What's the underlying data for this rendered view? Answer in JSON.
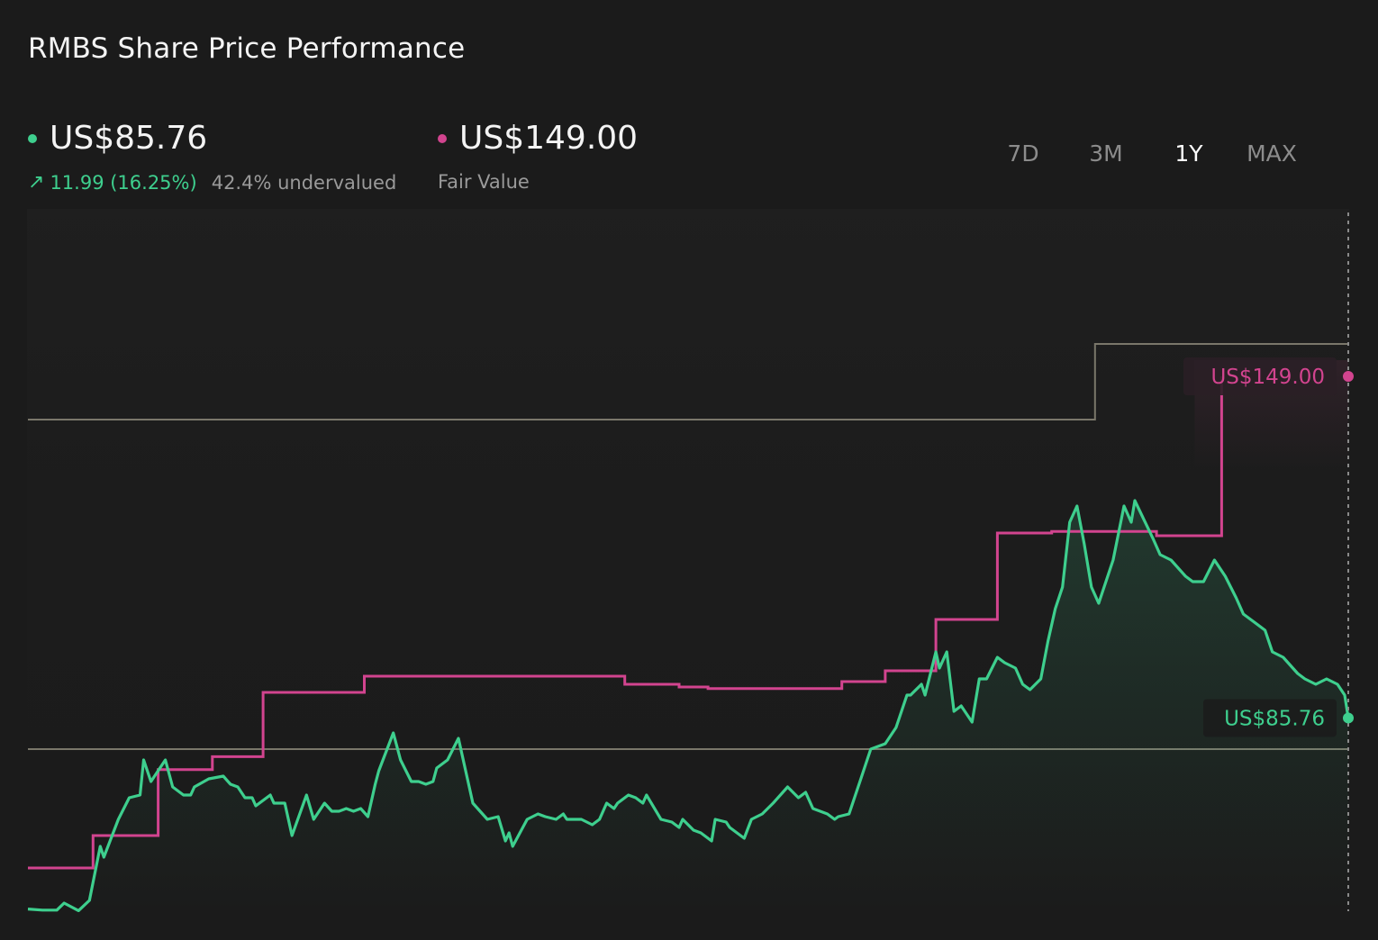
{
  "title": "RMBS Share Price Performance",
  "price": {
    "value": "US$85.76",
    "change": "11.99 (16.25%)",
    "change_arrow": "arrow-up-right-icon",
    "valuation": "42.4% undervalued",
    "color": "#3ecf8e"
  },
  "fair_value": {
    "value": "US$149.00",
    "label": "Fair Value",
    "color": "#d2448f"
  },
  "ranges": [
    {
      "label": "7D",
      "active": false
    },
    {
      "label": "3M",
      "active": false
    },
    {
      "label": "1Y",
      "active": true
    },
    {
      "label": "MAX",
      "active": false
    }
  ],
  "chart_data": {
    "type": "line",
    "x_range": [
      0,
      365
    ],
    "y_range": [
      50,
      180
    ],
    "price_label": "US$85.76",
    "fair_value_label": "US$149.00",
    "series": [
      {
        "name": "",
        "color": "#3ecf8e",
        "points": [
          [
            0,
            50.4
          ],
          [
            4,
            50.2
          ],
          [
            8,
            50.2
          ],
          [
            10,
            51.5
          ],
          [
            14,
            50.1
          ],
          [
            17,
            52
          ],
          [
            20,
            62
          ],
          [
            21,
            60
          ],
          [
            25,
            67
          ],
          [
            28,
            71
          ],
          [
            31,
            71.5
          ],
          [
            32,
            78
          ],
          [
            34,
            74
          ],
          [
            38,
            78
          ],
          [
            40,
            73
          ],
          [
            43,
            71.5
          ],
          [
            45,
            71.5
          ],
          [
            46,
            73
          ],
          [
            50,
            74.5
          ],
          [
            54,
            75
          ],
          [
            56,
            73.5
          ],
          [
            58,
            73
          ],
          [
            60,
            71
          ],
          [
            62,
            71
          ],
          [
            63,
            69.5
          ],
          [
            67,
            71.5
          ],
          [
            68,
            70
          ],
          [
            71,
            70
          ],
          [
            73,
            64
          ],
          [
            77,
            71.5
          ],
          [
            79,
            67
          ],
          [
            82,
            70
          ],
          [
            84,
            68.5
          ],
          [
            86,
            68.5
          ],
          [
            88,
            69
          ],
          [
            90,
            68.5
          ],
          [
            92,
            69
          ],
          [
            94,
            67.5
          ],
          [
            96,
            73.5
          ],
          [
            97,
            76
          ],
          [
            101,
            83
          ],
          [
            103,
            78
          ],
          [
            106,
            74
          ],
          [
            108,
            74
          ],
          [
            110,
            73.5
          ],
          [
            112,
            74
          ],
          [
            113,
            76.5
          ],
          [
            116,
            78
          ],
          [
            119,
            82
          ],
          [
            121,
            76
          ],
          [
            123,
            70
          ],
          [
            127,
            67
          ],
          [
            130,
            67.5
          ],
          [
            132,
            63
          ],
          [
            133,
            64.5
          ],
          [
            134,
            62
          ],
          [
            138,
            67
          ],
          [
            141,
            68
          ],
          [
            143,
            67.5
          ],
          [
            146,
            67
          ],
          [
            148,
            68
          ],
          [
            149,
            67
          ],
          [
            153,
            67
          ],
          [
            156,
            66
          ],
          [
            158,
            67
          ],
          [
            160,
            70
          ],
          [
            162,
            69
          ],
          [
            163,
            70
          ],
          [
            166,
            71.5
          ],
          [
            168,
            71
          ],
          [
            170,
            70
          ],
          [
            171,
            71.5
          ],
          [
            175,
            67
          ],
          [
            178,
            66.5
          ],
          [
            180,
            65.5
          ],
          [
            181,
            67
          ],
          [
            184,
            65
          ],
          [
            186,
            64.5
          ],
          [
            189,
            63
          ],
          [
            190,
            67
          ],
          [
            193,
            66.5
          ],
          [
            194,
            65.5
          ],
          [
            198,
            63.5
          ],
          [
            200,
            67
          ],
          [
            203,
            68
          ],
          [
            206,
            70
          ],
          [
            210,
            73
          ],
          [
            213,
            71
          ],
          [
            215,
            72
          ],
          [
            217,
            69
          ],
          [
            221,
            68
          ],
          [
            223,
            67
          ],
          [
            224,
            67.5
          ],
          [
            227,
            68
          ],
          [
            230,
            74
          ],
          [
            233,
            80
          ],
          [
            237,
            81
          ],
          [
            239,
            83
          ],
          [
            240,
            84
          ],
          [
            243,
            90
          ],
          [
            244,
            90
          ],
          [
            247,
            92
          ],
          [
            248,
            90
          ],
          [
            251,
            98
          ],
          [
            252,
            95
          ],
          [
            254,
            98
          ],
          [
            256,
            87
          ],
          [
            258,
            88
          ],
          [
            261,
            85
          ],
          [
            263,
            93
          ],
          [
            265,
            93
          ],
          [
            268,
            97
          ],
          [
            270,
            96
          ],
          [
            273,
            95
          ],
          [
            275,
            92
          ],
          [
            277,
            91
          ],
          [
            280,
            93
          ],
          [
            282,
            100
          ],
          [
            284,
            106
          ],
          [
            286,
            110
          ],
          [
            288,
            122
          ],
          [
            290,
            125
          ],
          [
            292,
            118
          ],
          [
            294,
            110
          ],
          [
            296,
            107
          ],
          [
            300,
            115
          ],
          [
            303,
            125
          ],
          [
            305,
            122
          ],
          [
            306,
            126
          ],
          [
            311,
            119
          ],
          [
            313,
            116
          ],
          [
            316,
            115
          ],
          [
            320,
            112
          ],
          [
            322,
            111
          ],
          [
            325,
            111
          ],
          [
            328,
            115
          ],
          [
            331,
            112
          ],
          [
            334,
            108
          ],
          [
            336,
            105
          ],
          [
            338,
            104
          ],
          [
            342,
            102
          ],
          [
            344,
            98
          ],
          [
            347,
            97
          ],
          [
            351,
            94
          ],
          [
            353,
            93
          ],
          [
            356,
            92
          ],
          [
            359,
            93
          ],
          [
            362,
            92
          ],
          [
            364,
            90
          ],
          [
            365,
            85.76
          ]
        ]
      },
      {
        "name": "",
        "color": "#d2448f",
        "points": [
          [
            0,
            58
          ],
          [
            18,
            58
          ],
          [
            18,
            64
          ],
          [
            36,
            64
          ],
          [
            36,
            76.2
          ],
          [
            51,
            76.2
          ],
          [
            51,
            78.6
          ],
          [
            65,
            78.6
          ],
          [
            65,
            90.5
          ],
          [
            93,
            90.5
          ],
          [
            93,
            93.5
          ],
          [
            165,
            93.5
          ],
          [
            165,
            92
          ],
          [
            180,
            92
          ],
          [
            180,
            91.5
          ],
          [
            188,
            91.5
          ],
          [
            188,
            91.2
          ],
          [
            225,
            91.2
          ],
          [
            225,
            92.5
          ],
          [
            237,
            92.5
          ],
          [
            237,
            94.5
          ],
          [
            251,
            94.5
          ],
          [
            251,
            104
          ],
          [
            268,
            104
          ],
          [
            268,
            120
          ],
          [
            283,
            120
          ],
          [
            283,
            120.3
          ],
          [
            312,
            120.3
          ],
          [
            312,
            119.5
          ],
          [
            330,
            119.5
          ],
          [
            330,
            149
          ]
        ]
      },
      {
        "name": "",
        "color": "#7a776a",
        "points": [
          [
            0,
            141
          ],
          [
            295,
            141
          ],
          [
            295,
            155
          ],
          [
            365,
            155
          ]
        ]
      },
      {
        "name": "",
        "color": "#7a776a",
        "points": [
          [
            0,
            80
          ],
          [
            365,
            80
          ]
        ]
      }
    ]
  }
}
